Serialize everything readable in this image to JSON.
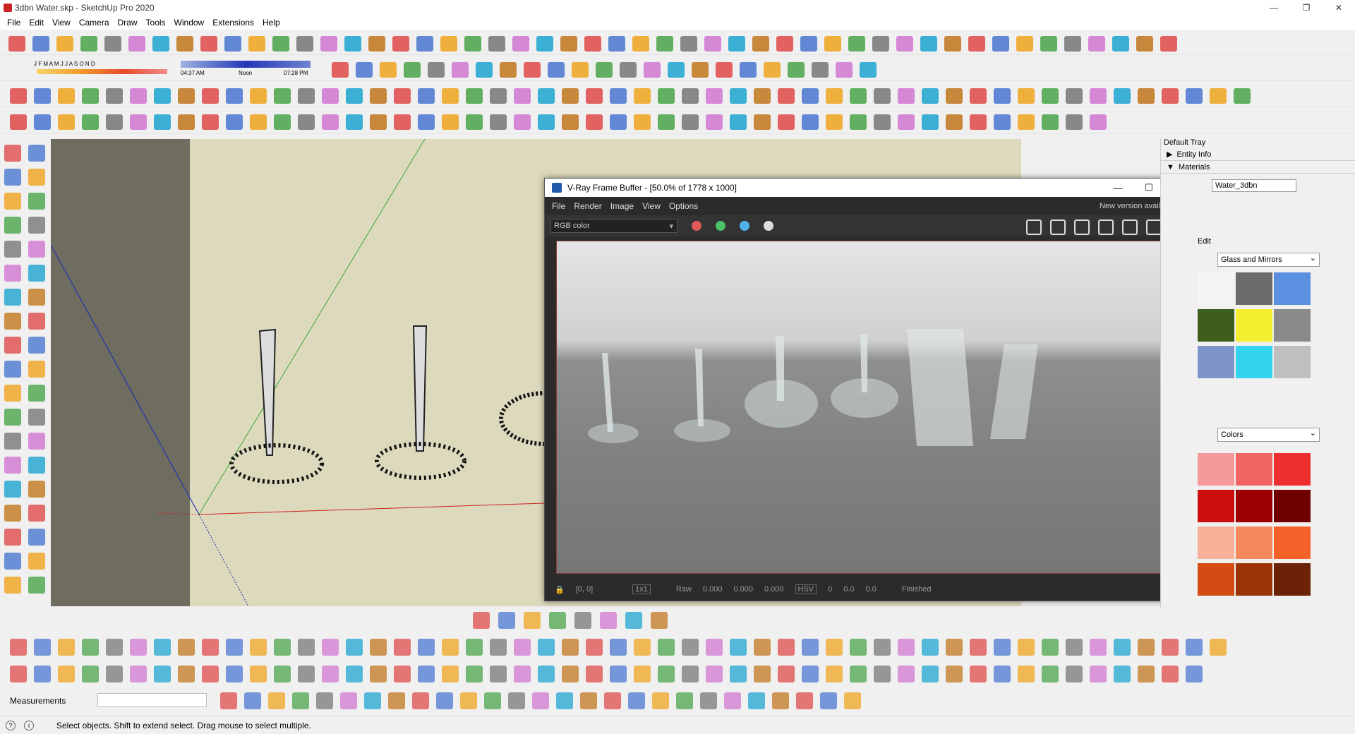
{
  "window": {
    "title": "3dbn Water.skp - SketchUp Pro 2020",
    "min": "—",
    "max": "❐",
    "close": "✕"
  },
  "menu": [
    "File",
    "Edit",
    "View",
    "Camera",
    "Draw",
    "Tools",
    "Window",
    "Extensions",
    "Help"
  ],
  "shadow_bar": {
    "months": "J  F  M  A  M  J  J  A  S  O  N  D",
    "time_start": "04:37 AM",
    "time_mid": "Noon",
    "time_end": "07:28 PM"
  },
  "vfb": {
    "title": "V-Ray Frame Buffer - [50.0% of 1778 x 1000]",
    "menu": [
      "File",
      "Render",
      "Image",
      "View",
      "Options"
    ],
    "new_version": "New version available!",
    "channel": "RGB color",
    "dot_colors": [
      "#e05a5a",
      "#4cc26a",
      "#4fb3e8",
      "#dddddd"
    ],
    "status": {
      "coords": "[0, 0]",
      "zoom": "1x1",
      "raw": "Raw",
      "v1": "0.000",
      "v2": "0.000",
      "v3": "0.000",
      "mode": "HSV",
      "h": "0",
      "s": "0.0",
      "v": "0.0",
      "state": "Finished"
    }
  },
  "tray": {
    "title": "Default Tray",
    "sections": [
      {
        "label": "Entity Info",
        "arrow": "▶"
      },
      {
        "label": "Materials",
        "arrow": "▼"
      }
    ],
    "material_name": "Water_3dbn",
    "edit": "Edit",
    "library1": "Glass and Mirrors",
    "library2": "Colors",
    "swatches1": [
      "#f4f4f4",
      "#6b6b6b",
      "#5b8fe0",
      "#3d5e1c",
      "#f4f030",
      "#8a8a8a",
      "#7f95c9",
      "#34d4f0",
      "#bfbfbf"
    ],
    "swatches2": [
      "#f59a9a",
      "#f06464",
      "#ee2f2f",
      "#cc0e0e",
      "#9c0000",
      "#6e0000",
      "#f8b198",
      "#f6895c",
      "#f4622a",
      "#d24c14",
      "#9c3408",
      "#6c2206"
    ]
  },
  "measurements_label": "Measurements",
  "status_text": "Select objects. Shift to extend select. Drag mouse to select multiple."
}
